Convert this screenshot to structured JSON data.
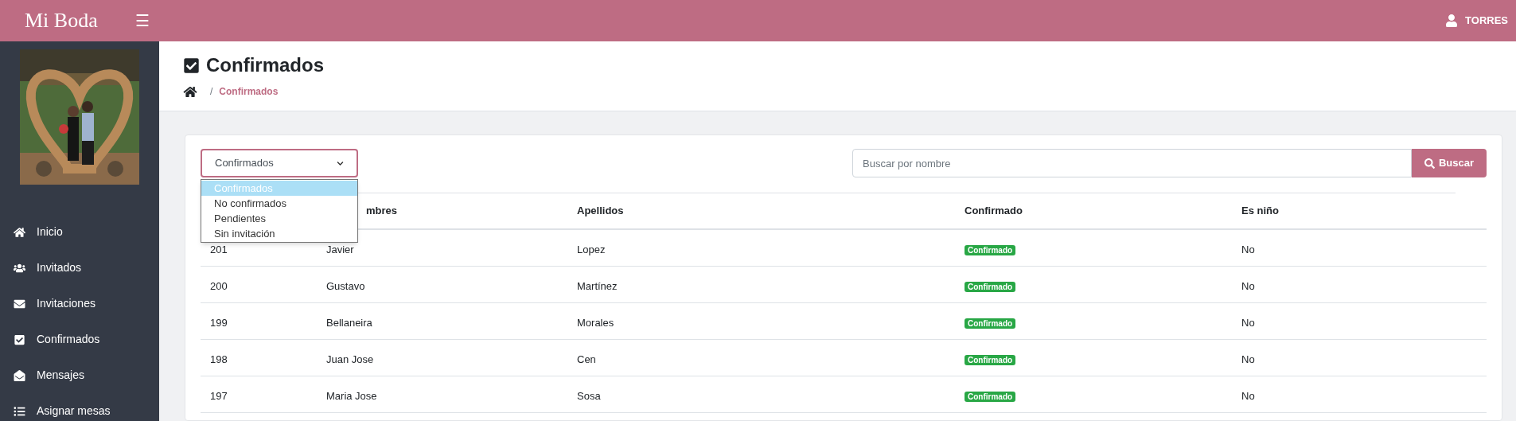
{
  "brand": "Mi Boda",
  "menu_icon": "☰",
  "user": {
    "name": "TORRES"
  },
  "sidebar": {
    "items": [
      {
        "label": "Inicio",
        "selected": false
      },
      {
        "label": "Invitados",
        "selected": false
      },
      {
        "label": "Invitaciones",
        "selected": false
      },
      {
        "label": "Confirmados",
        "selected": false
      },
      {
        "label": "Mensajes",
        "selected": false
      },
      {
        "label": "Asignar mesas",
        "selected": false
      }
    ]
  },
  "page": {
    "title": "Confirmados",
    "breadcrumb": [
      {
        "label": "/"
      },
      {
        "label": "Confirmados"
      }
    ]
  },
  "filter": {
    "value": "Confirmados",
    "options": [
      {
        "label": "Confirmados",
        "selected": true
      },
      {
        "label": "No confirmados",
        "selected": false
      },
      {
        "label": "Pendientes",
        "selected": false
      },
      {
        "label": "Sin invitación",
        "selected": false
      }
    ]
  },
  "search": {
    "placeholder": "Buscar por nombre",
    "button": "Buscar"
  },
  "table": {
    "columns": [
      "mbres",
      "Apellidos",
      "Confirmado",
      "Es niño"
    ],
    "rows": [
      {
        "id": "201",
        "nombre": "Javier",
        "apellido": "Lopez",
        "confirmado": "Confirmado",
        "nino": "No"
      },
      {
        "id": "200",
        "nombre": "Gustavo",
        "apellido": "Martínez",
        "confirmado": "Confirmado",
        "nino": "No"
      },
      {
        "id": "199",
        "nombre": "Bellaneira",
        "apellido": "Morales",
        "confirmado": "Confirmado",
        "nino": "No"
      },
      {
        "id": "198",
        "nombre": "Juan Jose",
        "apellido": "Cen",
        "confirmado": "Confirmado",
        "nino": "No"
      },
      {
        "id": "197",
        "nombre": "Maria Jose",
        "apellido": "Sosa",
        "confirmado": "Confirmado",
        "nino": "No"
      }
    ]
  }
}
